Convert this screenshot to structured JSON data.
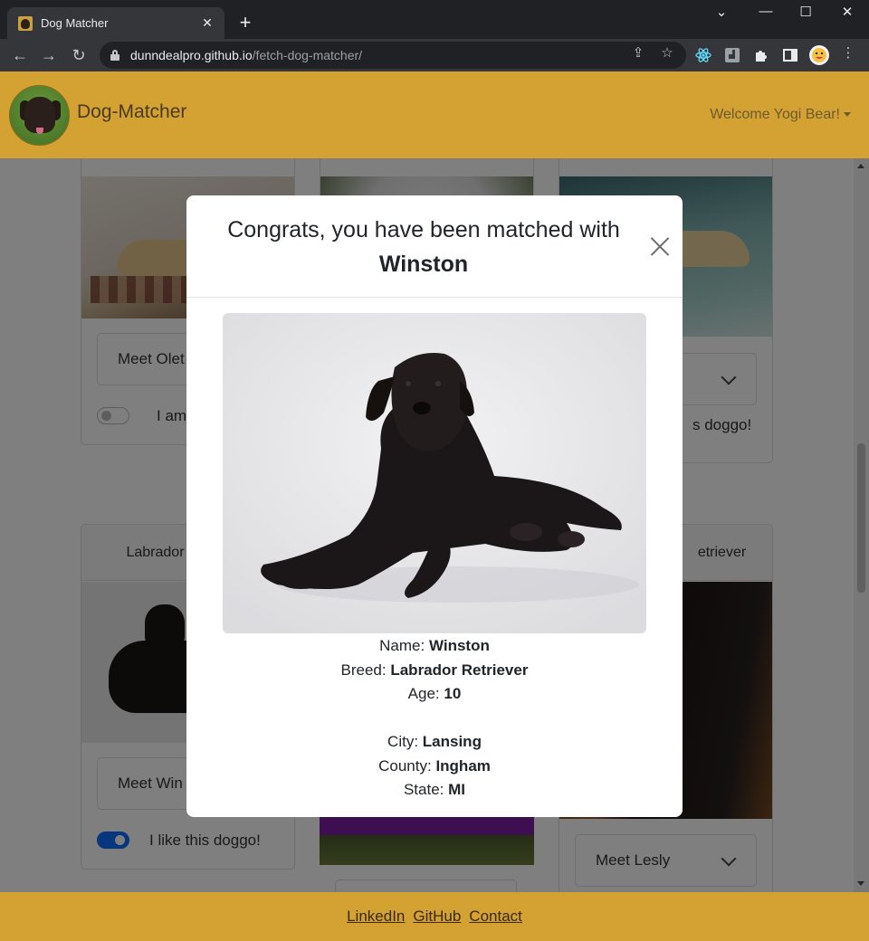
{
  "browser": {
    "tab_title": "Dog Matcher",
    "url_host": "dunndealpro.github.io",
    "url_path": "/fetch-dog-matcher/"
  },
  "navbar": {
    "brand": "Dog-Matcher",
    "welcome": "Welcome Yogi Bear!"
  },
  "cards": {
    "c1_meet": "Meet Olet",
    "c1_like": "I am",
    "c3_like": "s doggo!",
    "c4_breed": "Labrador",
    "c4_meet": "Meet Win",
    "c4_like": "I like this doggo!",
    "c6_breed": "etriever",
    "c6_meet": "Meet Lesly"
  },
  "modal": {
    "title_prefix": "Congrats, you have been matched with",
    "dog_name": "Winston",
    "name_label": "Name:",
    "name_value": "Winston",
    "breed_label": "Breed:",
    "breed_value": "Labrador Retriever",
    "age_label": "Age:",
    "age_value": "10",
    "city_label": "City:",
    "city_value": "Lansing",
    "county_label": "County:",
    "county_value": "Ingham",
    "state_label": "State:",
    "state_value": "MI"
  },
  "footer": {
    "linkedin": "LinkedIn",
    "github": "GitHub",
    "contact": "Contact"
  },
  "colors": {
    "navbar_bg": "#d4a233",
    "toggle_on": "#0d6efd",
    "purple_button": "#7a1fa2"
  }
}
